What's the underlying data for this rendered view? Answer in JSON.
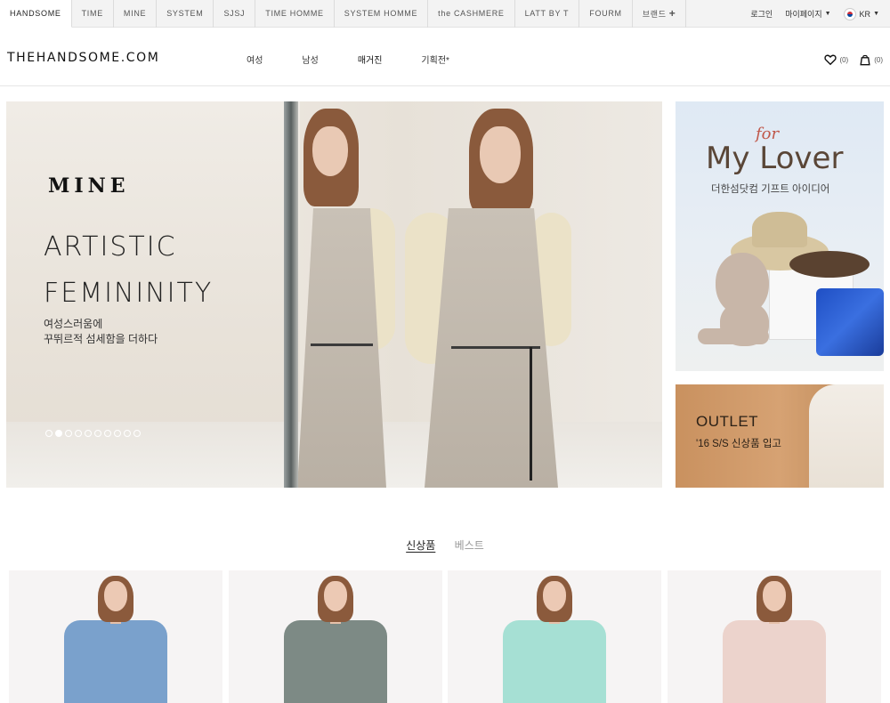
{
  "brand_nav": {
    "tabs": [
      "HANDSOME",
      "TIME",
      "MINE",
      "SYSTEM",
      "SJSJ",
      "TIME HOMME",
      "SYSTEM HOMME",
      "the CASHMERE",
      "LATT BY T",
      "FOURM",
      "브랜드"
    ],
    "active_index": 0
  },
  "utility": {
    "login": "로그인",
    "mypage": "마이페이지",
    "language": "KR"
  },
  "header": {
    "logo": "THEHANDSOME.COM",
    "menu": [
      "여성",
      "남성",
      "매거진",
      "기획전*"
    ],
    "wishlist_count": "(0)",
    "cart_count": "(0)"
  },
  "hero": {
    "brand": "MINE",
    "title": "ARTISTIC\nFEMININITY",
    "subtitle": "여성스러움에\n꾸뛰르적 섬세함을 더하다",
    "slide_count": 10,
    "active_slide": 1
  },
  "banner_lover": {
    "script": "for",
    "title": "My Lover",
    "subtitle": "더한섬닷컴 기프트 아이디어"
  },
  "banner_outlet": {
    "title": "OUTLET",
    "subtitle": "'16 S/S 신상품 입고"
  },
  "product_tabs": {
    "tabs": [
      "신상품",
      "베스트"
    ],
    "active_index": 0
  },
  "products": [
    {
      "top_color": "#7aa1cc"
    },
    {
      "top_color": "#7d8a85"
    },
    {
      "top_color": "#a6e0d4"
    },
    {
      "top_color": "#ecd3cc"
    }
  ],
  "colors": {
    "brand_bar_bg": "#f3f3f3",
    "outlet_bg": "#d29c6c",
    "accent_script": "#c0584a"
  }
}
